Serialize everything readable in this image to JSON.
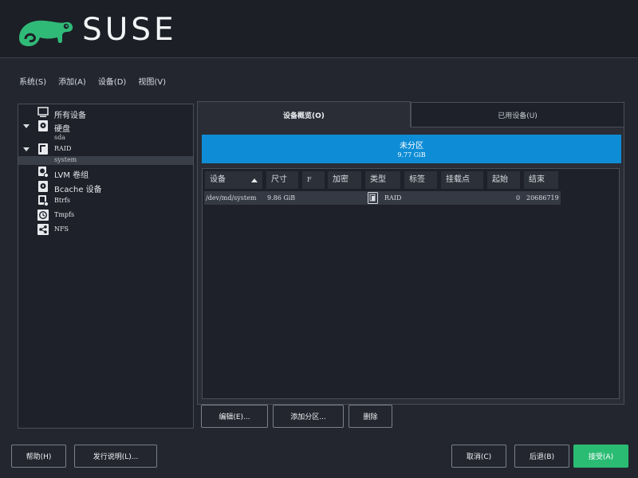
{
  "brand": {
    "name": "SUSE"
  },
  "menu": [
    "系统(S)",
    "添加(A)",
    "设备(D)",
    "视图(V)"
  ],
  "tree": {
    "all": "所有设备",
    "disks": "硬盘",
    "sda": "sda",
    "raid": "RAID",
    "system": "system",
    "lvm": "LVM 卷组",
    "bcache": "Bcache 设备",
    "btrfs": "Btrfs",
    "tmpfs": "Tmpfs",
    "nfs": "NFS"
  },
  "tabs": {
    "overview": "设备概览(O)",
    "used": "已用设备(U)"
  },
  "unpartitioned": {
    "label": "未分区",
    "size": "9.77 GiB"
  },
  "columns": [
    "设备",
    "尺寸",
    "F",
    "加密",
    "类型",
    "标签",
    "挂载点",
    "起始",
    "结束"
  ],
  "row": {
    "device": "/dev/md/system",
    "size": "9.86 GiB",
    "type": "RAID",
    "start": "0",
    "end": "20686719"
  },
  "actions": {
    "edit": "编辑(E)...",
    "add_partition": "添加分区...",
    "delete": "删除"
  },
  "footer": {
    "help": "帮助(H)",
    "release_notes": "发行说明(L)...",
    "cancel": "取消(C)",
    "back": "后退(B)",
    "accept": "接受(A)"
  },
  "colors": {
    "accent": "#2bbc73",
    "selection": "#0e8dd6",
    "background": "#23262f"
  },
  "icons": [
    "chameleon-logo-icon",
    "monitor-icon",
    "disk-icon",
    "raid-icon",
    "lvm-icon",
    "bcache-icon",
    "btrfs-icon",
    "tmpfs-icon",
    "nfs-icon",
    "sort-ascending-icon",
    "expand-arrow-icon"
  ]
}
